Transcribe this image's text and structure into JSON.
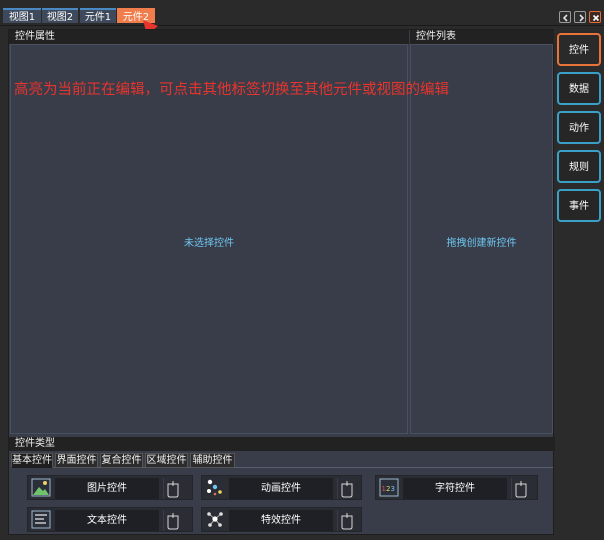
{
  "doc_tabs": [
    {
      "label": "视图1",
      "active": false
    },
    {
      "label": "视图2",
      "active": false
    },
    {
      "label": "元件1",
      "active": false
    },
    {
      "label": "元件2",
      "active": true
    }
  ],
  "nav": {
    "prev_icon": "chevron-left-icon",
    "next_icon": "chevron-right-icon",
    "close_icon": "close-icon"
  },
  "properties_panel": {
    "header": "控件属性",
    "empty_message": "未选择控件"
  },
  "list_panel": {
    "header": "控件列表",
    "empty_message": "拖拽创建新控件"
  },
  "annotation": {
    "text": "高亮为当前正在编辑，可点击其他标签切换至其他元件或视图的编辑",
    "color": "#e8342c"
  },
  "control_types": {
    "header": "控件类型",
    "tabs": [
      {
        "label": "基本控件",
        "active": true
      },
      {
        "label": "界面控件",
        "active": false
      },
      {
        "label": "复合控件",
        "active": false
      },
      {
        "label": "区域控件",
        "active": false
      },
      {
        "label": "辅助控件",
        "active": false
      }
    ],
    "items": [
      {
        "label": "图片控件",
        "icon": "image-icon"
      },
      {
        "label": "动画控件",
        "icon": "animation-icon"
      },
      {
        "label": "字符控件",
        "icon": "numeric-text-icon"
      },
      {
        "label": "文本控件",
        "icon": "text-icon"
      },
      {
        "label": "特效控件",
        "icon": "effect-icon"
      }
    ]
  },
  "sidebar": {
    "items": [
      {
        "label": "控件",
        "active": true
      },
      {
        "label": "数据",
        "active": false
      },
      {
        "label": "动作",
        "active": false
      },
      {
        "label": "规则",
        "active": false
      },
      {
        "label": "事件",
        "active": false
      }
    ]
  },
  "colors": {
    "accent": "#f07e4c",
    "highlight_blue": "#3aa0c8",
    "panel_bg": "#393d4a",
    "message_text": "#6ec8f0"
  }
}
